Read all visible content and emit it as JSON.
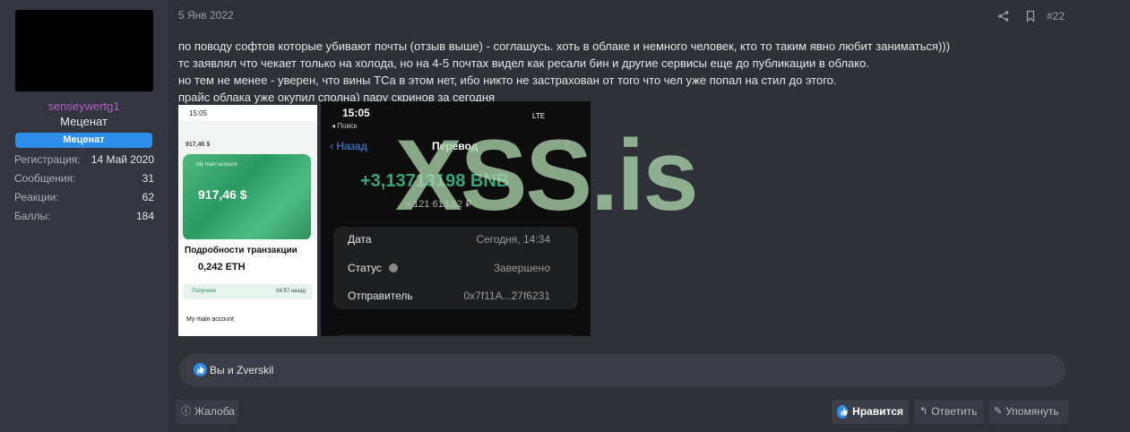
{
  "user": {
    "username": "senseywertg1",
    "title": "Меценат",
    "banner": "Меценат",
    "stats": [
      {
        "label": "Регистрация:",
        "value": "14 Май 2020"
      },
      {
        "label": "Сообщения:",
        "value": "31"
      },
      {
        "label": "Реакции:",
        "value": "62"
      },
      {
        "label": "Баллы:",
        "value": "184"
      }
    ]
  },
  "post": {
    "date": "5 Янв 2022",
    "number": "#22",
    "lines": [
      "по поводу софтов которые убивают почты (отзыв выше) - соглашусь. хоть в облаке и немного человек, кто то таким явно любит заниматься)))",
      "тс заявлял что чекает только на холода, но на 4-5 почтах видел как ресали бин и другие сервисы еще до публикации в облако.",
      "но тем не менее - уверен, что вины ТСа в этом нет, ибо никто не застрахован от того что чел уже попал на стил до этого.",
      "прайс облака уже окупил сполна) пару скринов за сегодня"
    ],
    "watermark": "XSS.is"
  },
  "screenshot1": {
    "time": "15:05",
    "label": "917,46 $",
    "account": "My main account",
    "amount": "917,46 $",
    "card_title": "Подробности транзакции",
    "eth_amount": "0,242 ETH",
    "row": "Получено",
    "row_time": "04:57 назад",
    "account2": "My main account"
  },
  "screenshot2": {
    "time": "15:05",
    "search": "◂ Поиск",
    "status": "LTE",
    "back": "Назад",
    "title": "Перевод",
    "amount": "+3,13713198 BNB",
    "sub": "≈ 121 613,92 ₽",
    "rows": [
      {
        "k": "Дата",
        "v": "Сегодня, 14:34"
      },
      {
        "k": "Статус",
        "v": "Завершено"
      },
      {
        "k": "Отправитель",
        "v": "0x7f11A...27f6231"
      }
    ]
  },
  "reactions": {
    "text": "Вы и Zverskil"
  },
  "footer": {
    "report": "Жалоба",
    "like": "Нравится",
    "reply": "Ответить",
    "quote": "Упомянуть"
  },
  "icons": {
    "share": "share-icon",
    "bookmark": "bookmark-icon",
    "like": "thumbs-up-icon"
  },
  "colors": {
    "accent": "#2f8dea",
    "username": "#b05ec8",
    "watermark": "#aad4aa"
  }
}
